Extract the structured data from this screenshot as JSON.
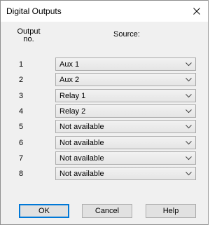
{
  "window": {
    "title": "Digital Outputs",
    "close_icon": "close-icon"
  },
  "header": {
    "output_col_line1": "Output",
    "output_col_line2": "no.",
    "source_col": "Source:"
  },
  "rows": [
    {
      "number": "1",
      "source": "Aux 1"
    },
    {
      "number": "2",
      "source": "Aux 2"
    },
    {
      "number": "3",
      "source": "Relay 1"
    },
    {
      "number": "4",
      "source": "Relay 2"
    },
    {
      "number": "5",
      "source": "Not available"
    },
    {
      "number": "6",
      "source": "Not available"
    },
    {
      "number": "7",
      "source": "Not available"
    },
    {
      "number": "8",
      "source": "Not available"
    }
  ],
  "buttons": {
    "ok": "OK",
    "cancel": "Cancel",
    "help": "Help"
  },
  "colors": {
    "dialog_bg": "#f0f0f0",
    "titlebar_bg": "#ffffff",
    "combo_border": "#acacac",
    "button_bg": "#e1e1e1",
    "default_button_border": "#0078d7"
  }
}
